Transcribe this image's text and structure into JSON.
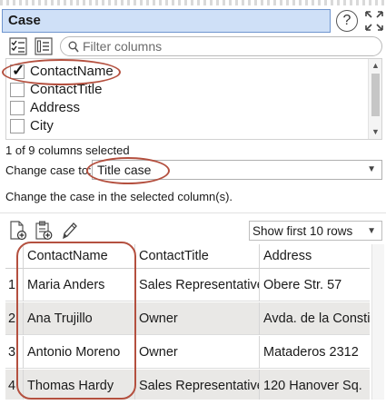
{
  "header": {
    "title": "Case",
    "help_label": "?"
  },
  "filter": {
    "placeholder": "Filter columns"
  },
  "columns": [
    {
      "label": "ContactName",
      "checked": true
    },
    {
      "label": "ContactTitle",
      "checked": false
    },
    {
      "label": "Address",
      "checked": false
    },
    {
      "label": "City",
      "checked": false
    }
  ],
  "status_text": "1 of 9 columns selected",
  "change_case": {
    "label": "Change case to:",
    "value": "Title case"
  },
  "description": "Change the case in the selected column(s).",
  "preview": {
    "show_rows": "Show first 10 rows"
  },
  "table": {
    "headers": [
      "",
      "ContactName",
      "ContactTitle",
      "Address"
    ],
    "rows": [
      [
        "1",
        "Maria Anders",
        "Sales Representative",
        "Obere Str. 57"
      ],
      [
        "2",
        "Ana Trujillo",
        "Owner",
        "Avda. de la Constit"
      ],
      [
        "3",
        "Antonio Moreno",
        "Owner",
        "Mataderos  2312"
      ],
      [
        "4",
        "Thomas Hardy",
        "Sales Representative",
        "120 Hanover Sq."
      ]
    ]
  },
  "colors": {
    "title_bg": "#cfe0f7",
    "annotation": "#b4503f",
    "row_alt": "#e9e8e6"
  }
}
